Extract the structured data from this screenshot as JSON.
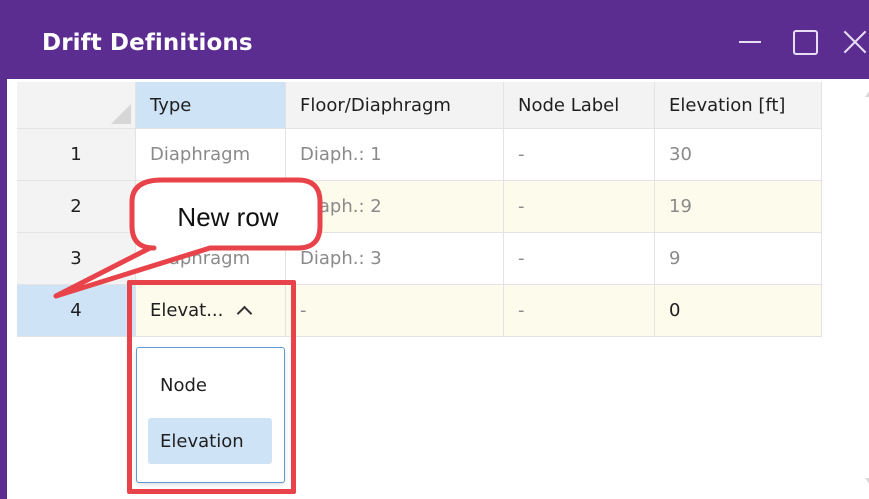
{
  "window": {
    "title": "Drift Definitions"
  },
  "grid": {
    "columns": [
      "Type",
      "Floor/Diaphragm",
      "Node Label",
      "Elevation [ft]"
    ],
    "rows": [
      {
        "num": "1",
        "type": "Diaphragm",
        "floor": "Diaph.: 1",
        "node": "-",
        "elev": "30"
      },
      {
        "num": "2",
        "type": "",
        "floor": "Diaph.: 2",
        "node": "-",
        "elev": "19"
      },
      {
        "num": "3",
        "type": "Diaphragm",
        "floor": "Diaph.: 3",
        "node": "-",
        "elev": "9"
      },
      {
        "num": "4",
        "type": "Elevat...",
        "floor": "-",
        "node": "-",
        "elev": "0"
      }
    ]
  },
  "dropdown": {
    "options": [
      "Node",
      "Elevation"
    ],
    "selected": "Elevation"
  },
  "callout": {
    "text": "New row"
  },
  "colors": {
    "titlebar": "#5c2d91",
    "highlight": "#cfe3f7",
    "annotation_red": "#e8434b",
    "edited_row": "#fdfbec"
  }
}
